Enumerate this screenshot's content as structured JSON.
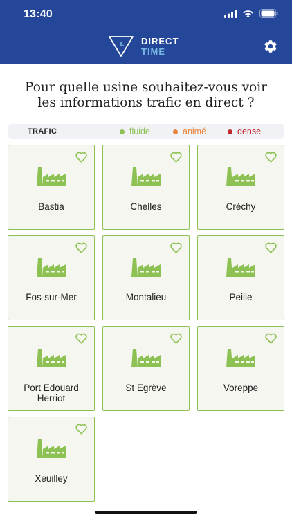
{
  "status_bar": {
    "time": "13:40"
  },
  "brand": {
    "line1": "DIRECT",
    "line2": "TIME"
  },
  "question": {
    "line1": "Pour quelle usine souhaitez-vous voir",
    "line2": "les informations trafic en direct ?"
  },
  "legend": {
    "title": "TRAFIC",
    "items": [
      {
        "label": "fluide",
        "color": "#8dc153"
      },
      {
        "label": "animé",
        "color": "#e8833a"
      },
      {
        "label": "dense",
        "color": "#c0282d"
      }
    ]
  },
  "colors": {
    "header": "#24479a",
    "accent_green": "#8dc153",
    "card_bg": "#f4f6ef"
  },
  "plants": [
    {
      "name_line1": "Bastia",
      "name_line2": ""
    },
    {
      "name_line1": "Chelles",
      "name_line2": ""
    },
    {
      "name_line1": "Créchy",
      "name_line2": ""
    },
    {
      "name_line1": "Fos-sur-Mer",
      "name_line2": ""
    },
    {
      "name_line1": "Montalieu",
      "name_line2": ""
    },
    {
      "name_line1": "Peille",
      "name_line2": ""
    },
    {
      "name_line1": "Port Edouard",
      "name_line2": "Herriot"
    },
    {
      "name_line1": "St Egrève",
      "name_line2": ""
    },
    {
      "name_line1": "Voreppe",
      "name_line2": ""
    },
    {
      "name_line1": "Xeuilley",
      "name_line2": ""
    }
  ],
  "icons": {
    "favorite": "heart-outline-icon",
    "plant": "factory-icon",
    "settings": "gear-icon"
  }
}
